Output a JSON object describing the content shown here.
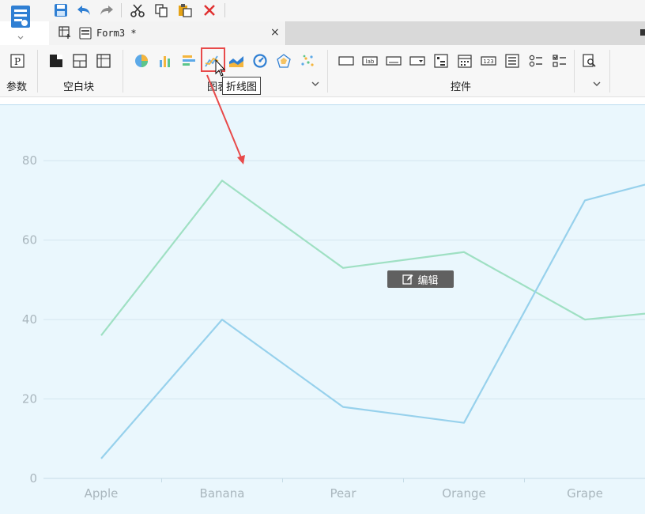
{
  "quickbar": {
    "icons": [
      "save-icon",
      "undo-icon",
      "redo-icon",
      "cut-icon",
      "copy-icon",
      "paste-icon",
      "delete-icon"
    ]
  },
  "tab": {
    "label": "Form3 *",
    "close": "×"
  },
  "ribbon": {
    "param_label": "参数",
    "param_icon_text": "P",
    "blank_block_label": "空白块",
    "chart_label": "图表",
    "widgets_label": "控件",
    "tooltip": "折线图",
    "widget_small_labels": {
      "lab": "lab",
      "num": "123"
    }
  },
  "edit_badge": {
    "label": "编辑"
  },
  "colors": {
    "canvas_bg": "#eaf7fd",
    "series_green": "#9fe0c3",
    "series_blue": "#97d1ec",
    "grid": "#d3e6ef",
    "axis_text": "#a9b6bd",
    "highlight": "#e84a4a"
  },
  "chart_data": {
    "type": "line",
    "categories": [
      "Apple",
      "Banana",
      "Pear",
      "Orange",
      "Grape",
      ""
    ],
    "y_ticks": [
      "0",
      "20",
      "40",
      "60",
      "80"
    ],
    "ylim": [
      0,
      90
    ],
    "grid": true,
    "series": [
      {
        "values": [
          36,
          75,
          53,
          57,
          40,
          43
        ],
        "color": "#9fe0c3"
      },
      {
        "values": [
          5,
          40,
          18,
          14,
          70,
          78
        ],
        "color": "#97d1ec"
      }
    ]
  }
}
